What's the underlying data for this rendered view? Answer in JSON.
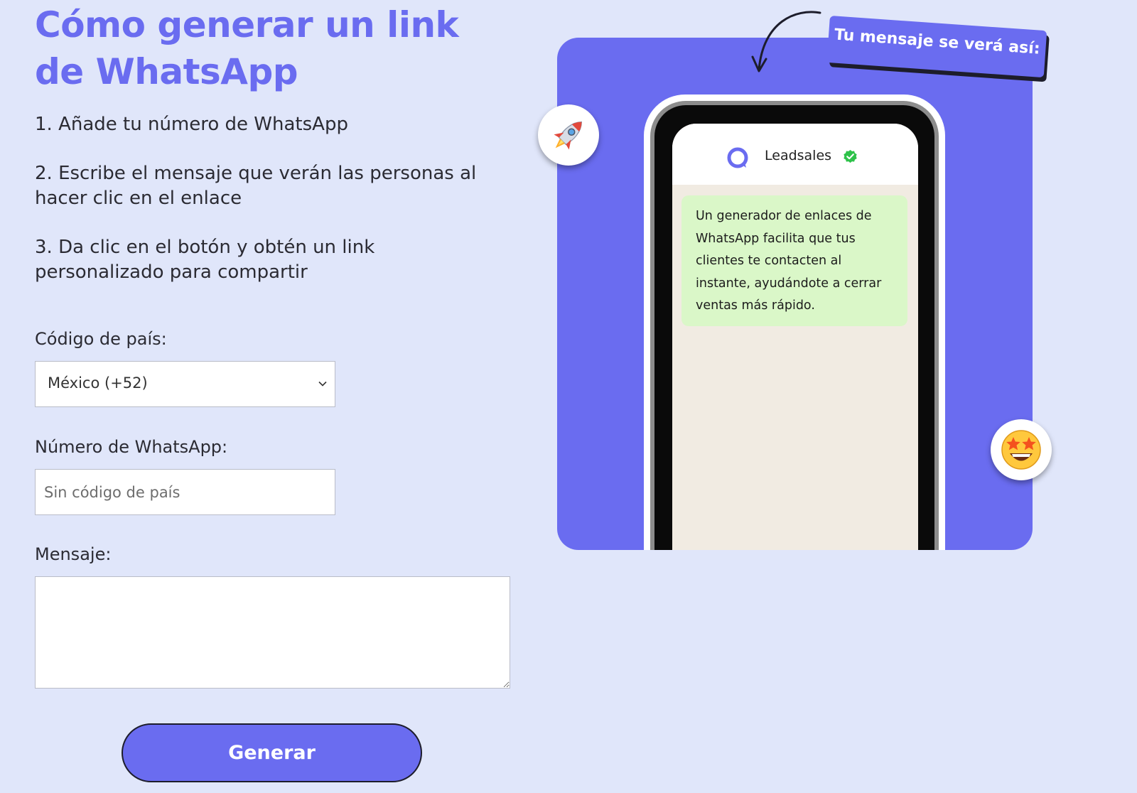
{
  "page": {
    "title": "Cómo generar un link de WhatsApp",
    "steps": [
      "1. Añade tu número de WhatsApp",
      "2. Escribe el mensaje que verán las personas al hacer clic en el enlace",
      "3. Da clic en el botón y obtén un link personalizado para compartir"
    ]
  },
  "form": {
    "country_label": "Código de país:",
    "country_value": "México (+52)",
    "number_label": "Número de WhatsApp:",
    "number_placeholder": "Sin código de país",
    "message_label": "Mensaje:",
    "message_value": "",
    "submit_label": "Generar"
  },
  "preview": {
    "tag_label": "Tu mensaje se verá así:",
    "brand_name": "Leadsales",
    "bubble_text": "Un generador de enlaces de WhatsApp facilita que tus clientes te contacten al instante, ayudándote a cerrar ventas más rápido."
  },
  "icons": {
    "verified": "verified-check-icon",
    "logo": "leadsales-logo-icon",
    "rocket": "rocket-emoji-icon",
    "star": "star-struck-emoji-icon",
    "chevron": "chevron-down-icon",
    "arrow": "curved-arrow-icon"
  },
  "colors": {
    "background": "#e0e6fa",
    "accent": "#6a6cf0",
    "bubble": "#daf7c8",
    "verified": "#2ec24a"
  }
}
